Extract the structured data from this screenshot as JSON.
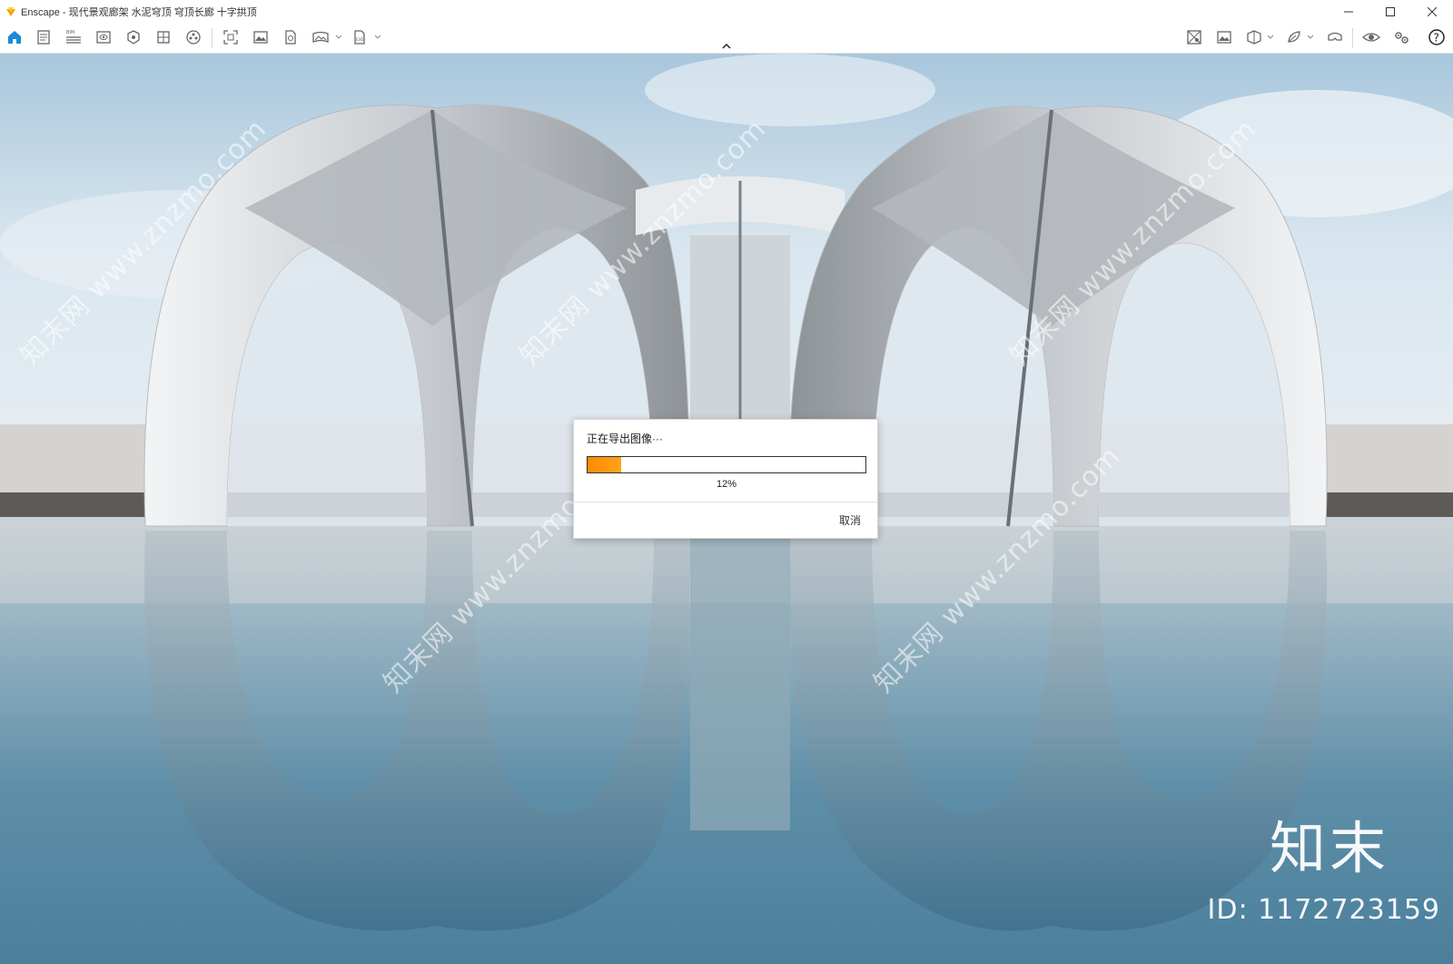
{
  "window": {
    "title": "Enscape - 现代景观廊架 水泥穹顶 穹顶长廊 十字拱顶",
    "controls": [
      "minimize",
      "maximize",
      "close"
    ]
  },
  "toolbar": {
    "left_icons": [
      "home-icon",
      "document-icon",
      "bim-icon",
      "view-eye-icon",
      "asset-icon",
      "material-icon",
      "atmosphere-icon",
      "screenshot-icon",
      "image-icon",
      "export-file-icon",
      "panorama-icon",
      "exe-export-icon"
    ],
    "bim_label": "BIM",
    "right_icons": [
      "minimap-icon",
      "visual-settings-icon",
      "section-icon",
      "asset-library-icon",
      "vr-headset-icon",
      "preview-eye-icon",
      "settings-gear-icon",
      "help-icon"
    ]
  },
  "dialog": {
    "title": "正在导出图像···",
    "progress": 0.12,
    "progress_label": "12%",
    "cancel_label": "取消",
    "accent_color": "#ff8a00"
  },
  "watermark": {
    "repeat_text": "知末网 www.znzmo.com",
    "brand": "知末",
    "id_label": "ID: 1172723159"
  }
}
